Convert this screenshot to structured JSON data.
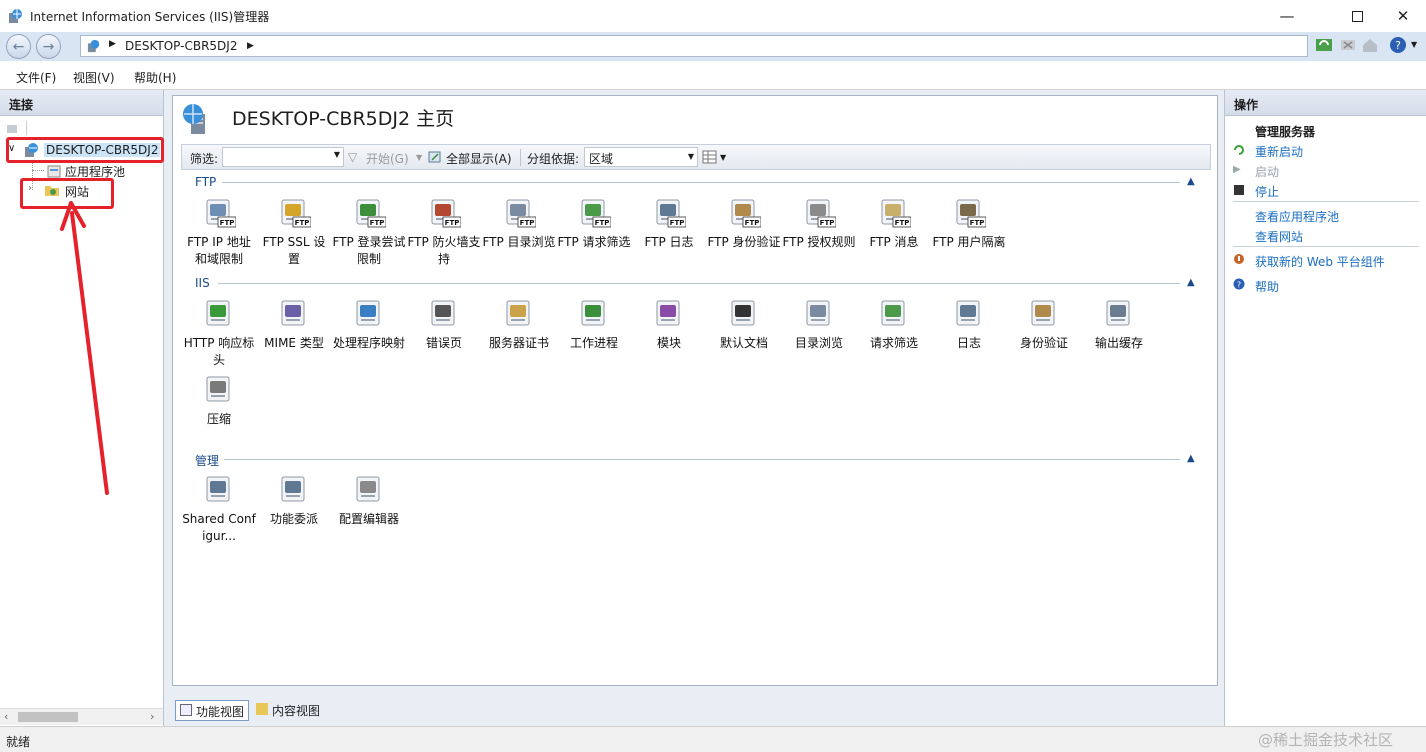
{
  "window": {
    "title": "Internet Information Services (IIS)管理器"
  },
  "address": {
    "crumb": "DESKTOP-CBR5DJ2"
  },
  "menu": [
    "文件(F)",
    "视图(V)",
    "帮助(H)"
  ],
  "left_panel": {
    "title": "连接",
    "tree": {
      "root": "DESKTOP-CBR5DJ2",
      "app_pools": "应用程序池",
      "sites": "网站"
    }
  },
  "center": {
    "title": "DESKTOP-CBR5DJ2 主页",
    "filter": {
      "label": "筛选:",
      "start": "开始(G)",
      "show_all": "全部显示(A)",
      "group_label": "分组依据:",
      "group_value": "区域"
    },
    "sections": [
      {
        "name": "FTP",
        "items": [
          {
            "label": "FTP IP 地址和域限制",
            "icon": "ftp-ip-restriction-icon",
            "color": "#6d8fb3"
          },
          {
            "label": "FTP SSL 设置",
            "icon": "ftp-ssl-lock-icon",
            "color": "#d4a52a"
          },
          {
            "label": "FTP 登录尝试限制",
            "icon": "ftp-logon-globe-icon",
            "color": "#3b8f3b"
          },
          {
            "label": "FTP 防火墙支持",
            "icon": "ftp-firewall-icon",
            "color": "#b3472f"
          },
          {
            "label": "FTP 目录浏览",
            "icon": "ftp-dir-browse-icon",
            "color": "#7a8aa0"
          },
          {
            "label": "FTP 请求筛选",
            "icon": "ftp-request-filter-icon",
            "color": "#4a9a4a"
          },
          {
            "label": "FTP 日志",
            "icon": "ftp-log-icon",
            "color": "#5f7894"
          },
          {
            "label": "FTP 身份验证",
            "icon": "ftp-auth-icon",
            "color": "#b08a4a"
          },
          {
            "label": "FTP 授权规则",
            "icon": "ftp-authz-key-icon",
            "color": "#8b8b8b"
          },
          {
            "label": "FTP 消息",
            "icon": "ftp-message-icon",
            "color": "#c9b06a"
          },
          {
            "label": "FTP 用户隔离",
            "icon": "ftp-user-isolation-icon",
            "color": "#7b6a4a"
          }
        ]
      },
      {
        "name": "IIS",
        "items": [
          {
            "label": "HTTP 响应标头",
            "icon": "http-headers-icon",
            "color": "#3a9a3a"
          },
          {
            "label": "MIME 类型",
            "icon": "mime-types-icon",
            "color": "#6b5fa8"
          },
          {
            "label": "处理程序映射",
            "icon": "handler-mappings-icon",
            "color": "#3a7fc2"
          },
          {
            "label": "错误页",
            "icon": "error-pages-icon",
            "color": "#555555"
          },
          {
            "label": "服务器证书",
            "icon": "server-certificates-icon",
            "color": "#c9a24a"
          },
          {
            "label": "工作进程",
            "icon": "worker-processes-icon",
            "color": "#3b8f3b"
          },
          {
            "label": "模块",
            "icon": "modules-icon",
            "color": "#8a4aa8"
          },
          {
            "label": "默认文档",
            "icon": "default-document-icon",
            "color": "#333333"
          },
          {
            "label": "目录浏览",
            "icon": "directory-browsing-icon",
            "color": "#7a8aa0"
          },
          {
            "label": "请求筛选",
            "icon": "request-filtering-icon",
            "color": "#4a9a4a"
          },
          {
            "label": "日志",
            "icon": "logging-icon",
            "color": "#5f7894"
          },
          {
            "label": "身份验证",
            "icon": "authentication-icon",
            "color": "#b08a4a"
          },
          {
            "label": "输出缓存",
            "icon": "output-caching-icon",
            "color": "#6a7c90"
          },
          {
            "label": "压缩",
            "icon": "compression-icon",
            "color": "#7a7a7a"
          }
        ]
      },
      {
        "name": "管理",
        "items": [
          {
            "label": "Shared Configur...",
            "icon": "shared-config-icon",
            "color": "#5f7894"
          },
          {
            "label": "功能委派",
            "icon": "feature-delegation-icon",
            "color": "#5f7894"
          },
          {
            "label": "配置编辑器",
            "icon": "config-editor-icon",
            "color": "#8a8a8a"
          }
        ]
      }
    ],
    "view_tabs": {
      "features": "功能视图",
      "content": "内容视图"
    }
  },
  "right_panel": {
    "title": "操作",
    "group": "管理服务器",
    "actions": {
      "restart": "重新启动",
      "start": "启动",
      "stop": "停止",
      "view_pools": "查看应用程序池",
      "view_sites": "查看网站",
      "web_pi": "获取新的 Web 平台组件",
      "help": "帮助"
    }
  },
  "status": {
    "text": "就绪",
    "watermark": "@稀土掘金技术社区"
  }
}
